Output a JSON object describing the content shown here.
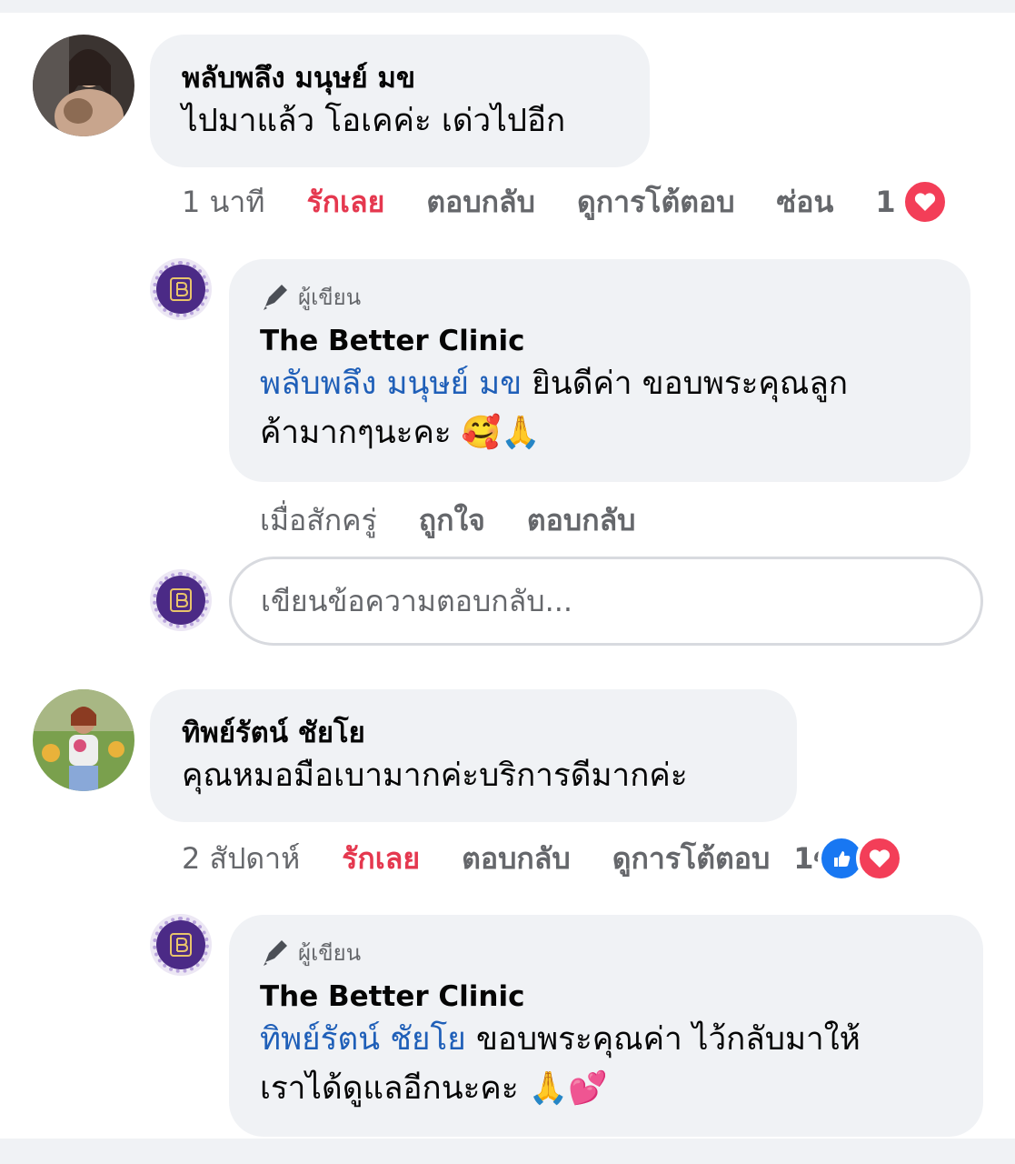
{
  "comments": [
    {
      "user": "พลับพลึง มนุษย์ มข",
      "text": "ไปมาแล้ว โอเคค่ะ เด่วไปอีก",
      "time": "1 นาที",
      "love": "รักเลย",
      "reply": "ตอบกลับ",
      "view": "ดูการโต้ตอบ",
      "hide": "ซ่อน",
      "reaction_count": "1"
    },
    {
      "user": "ทิพย์รัตน์ ชัยโย",
      "text": "คุณหมอมือเบามากค่ะบริการดีมากค่ะ",
      "time": "2 สัปดาห์",
      "love": "รักเลย",
      "reply": "ตอบกลับ",
      "view": "ดูการโต้ตอบ",
      "overlap": "1ซ่อ",
      "reaction_count": "1"
    }
  ],
  "replies": [
    {
      "author_badge": "ผู้เขียน",
      "page": "The Better Clinic",
      "mention": "พลับพลึง มนุษย์ มข",
      "line1": " ยินดีค่า ขอบพระคุณลูก",
      "line2": "ค้ามากๆนะคะ 🥰🙏",
      "time": "เมื่อสักครู่",
      "like": "ถูกใจ",
      "reply": "ตอบกลับ"
    },
    {
      "author_badge": "ผู้เขียน",
      "page": "The Better Clinic",
      "mention": "ทิพย์รัตน์ ชัยโย",
      "line1": " ขอบพระคุณค่า ไว้กลับมาให้",
      "line2": "เราได้ดูแลอีกนะคะ 🙏💕"
    }
  ],
  "reply_box": {
    "placeholder": "เขียนข้อความตอบกลับ..."
  },
  "icons": {
    "pen": "pen-icon",
    "heart": "heart-icon",
    "like": "like-icon"
  },
  "colors": {
    "love": "#e5384f",
    "mention": "#1f5fb8",
    "bubble": "#f0f2f5",
    "clinic": "#4b2a86"
  }
}
